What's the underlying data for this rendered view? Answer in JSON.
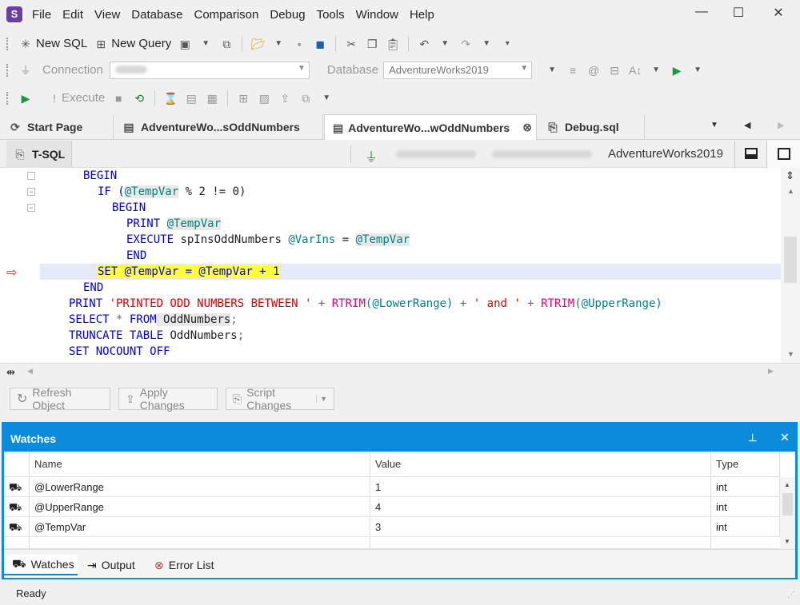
{
  "menu": [
    "File",
    "Edit",
    "View",
    "Database",
    "Comparison",
    "Debug",
    "Tools",
    "Window",
    "Help"
  ],
  "toolbar1": {
    "new_sql": "New SQL",
    "new_query": "New Query"
  },
  "toolbar2": {
    "connection_label": "Connection",
    "database_label": "Database",
    "database_value": "AdventureWorks2019"
  },
  "toolbar3": {
    "execute": "Execute"
  },
  "tabs": {
    "start_page": "Start Page",
    "tab1": "AdventureWo...sOddNumbers",
    "tab2": "AdventureWo...wOddNumbers",
    "tab3": "Debug.sql"
  },
  "docbar": {
    "mode": "T-SQL",
    "database": "AdventureWorks2019"
  },
  "code": {
    "l1": "BEGIN",
    "l2_if": "IF (",
    "l2_var": "@TempVar",
    "l2_rest": " % 2 != 0)",
    "l3": "BEGIN",
    "l4_kw": "PRINT ",
    "l4_var": "@TempVar",
    "l5_kw": "EXECUTE",
    "l5_proc": " spInsOddNumbers ",
    "l5_var1": "@VarIns",
    "l5_eq": " = ",
    "l5_var2": "@TempVar",
    "l6": "END",
    "l7": "SET @TempVar = @TempVar + 1",
    "l8": "END",
    "l9_kw": "PRINT ",
    "l9_str1": "'PRINTED ODD NUMBERS BETWEEN '",
    "l9_op1": " + ",
    "l9_fn1": "RTRIM",
    "l9_arg1": "(@LowerRange)",
    "l9_op2": " + ",
    "l9_str2": "' and '",
    "l9_op3": " + ",
    "l9_fn2": "RTRIM",
    "l9_arg2": "(@UpperRange)",
    "l10_kw": "SELECT",
    "l10_rest": " * ",
    "l10_from": "FROM",
    "l10_tbl": " OddNumbers",
    "l10_end": ";",
    "l11_kw": "TRUNCATE TABLE",
    "l11_tbl": " OddNumbers",
    "l11_end": ";",
    "l12": "SET NOCOUNT OFF"
  },
  "actions": {
    "refresh": "Refresh Object",
    "apply": "Apply Changes",
    "script": "Script Changes"
  },
  "watches": {
    "title": "Watches",
    "columns": [
      "Name",
      "Value",
      "Type"
    ],
    "rows": [
      {
        "name": "@LowerRange",
        "value": "1",
        "type": "int"
      },
      {
        "name": "@UpperRange",
        "value": "4",
        "type": "int"
      },
      {
        "name": "@TempVar",
        "value": "3",
        "type": "int"
      }
    ],
    "bottom_tabs": [
      "Watches",
      "Output",
      "Error List"
    ]
  },
  "status": "Ready",
  "colors": {
    "accent": "#0b8bd9",
    "keyword": "#0000ee",
    "string": "#e00000",
    "variable": "#008080",
    "highlight": "#ffff3a"
  }
}
